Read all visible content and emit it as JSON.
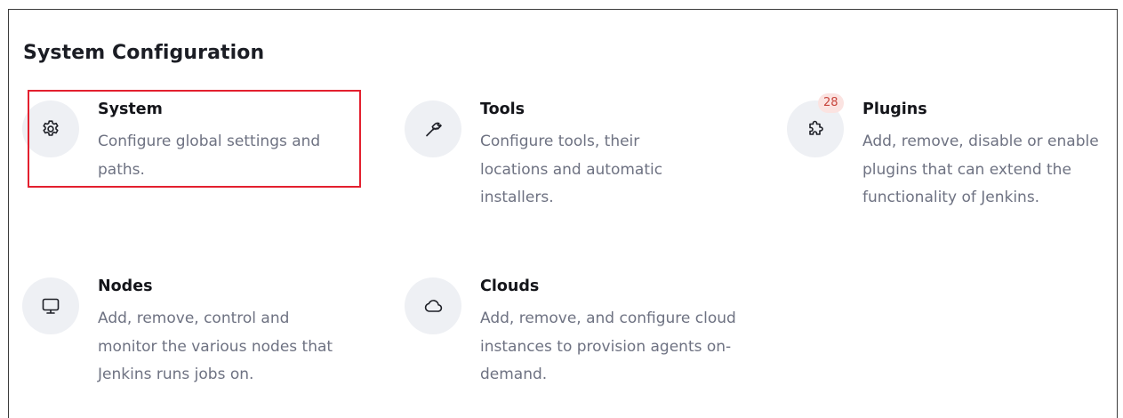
{
  "section": {
    "title": "System Configuration"
  },
  "items": [
    {
      "title": "System",
      "description": "Configure global settings and paths.",
      "icon": "gear-icon"
    },
    {
      "title": "Tools",
      "description": "Configure tools, their locations and automatic installers.",
      "icon": "hammer-icon"
    },
    {
      "title": "Plugins",
      "description": "Add, remove, disable or enable plugins that can extend the functionality of Jenkins.",
      "icon": "puzzle-icon",
      "badge": "28"
    },
    {
      "title": "Nodes",
      "description": "Add, remove, control and monitor the various nodes that Jenkins runs jobs on.",
      "icon": "monitor-icon"
    },
    {
      "title": "Clouds",
      "description": "Add, remove, and configure cloud instances to provision agents on-demand.",
      "icon": "cloud-icon"
    }
  ],
  "colors": {
    "highlight": "#e3202f",
    "badge_bg": "#fbe3e1",
    "badge_text": "#c8463d",
    "icon_bg": "#eef0f4"
  }
}
